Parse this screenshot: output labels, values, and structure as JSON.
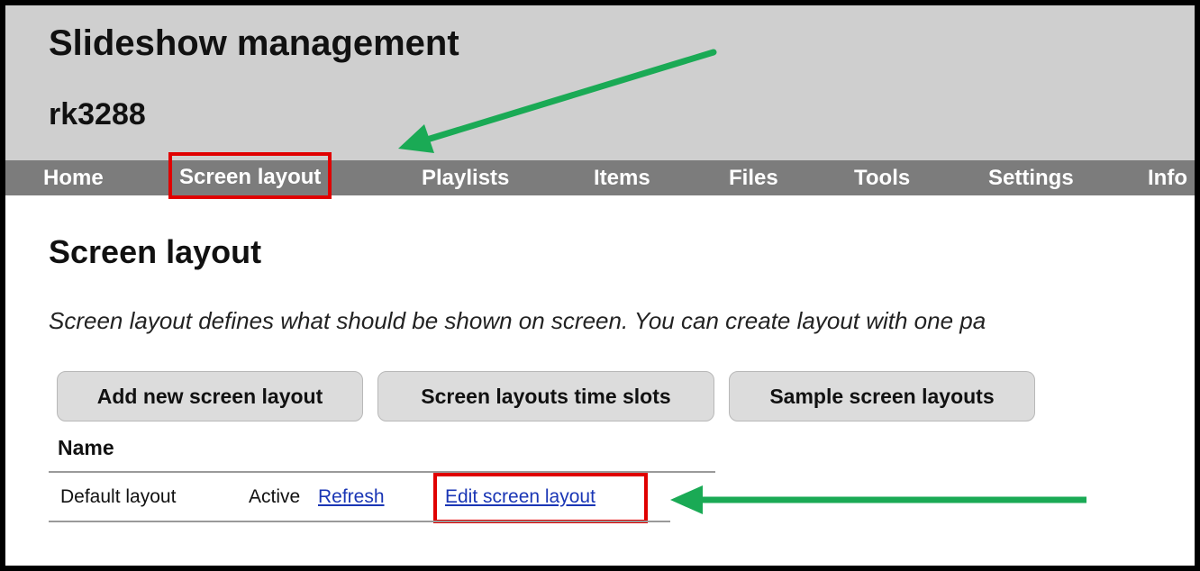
{
  "app": {
    "title": "Slideshow management",
    "device": "rk3288"
  },
  "nav": {
    "items": [
      {
        "label": "Home",
        "active": false
      },
      {
        "label": "Screen layout",
        "active": true
      },
      {
        "label": "Playlists",
        "active": false
      },
      {
        "label": "Items",
        "active": false
      },
      {
        "label": "Files",
        "active": false
      },
      {
        "label": "Tools",
        "active": false
      },
      {
        "label": "Settings",
        "active": false
      },
      {
        "label": "Info",
        "active": false
      }
    ]
  },
  "page": {
    "title": "Screen layout",
    "description": "Screen layout defines what should be shown on screen. You can create layout with one pa"
  },
  "buttons": {
    "add_new": "Add new screen layout",
    "time_slots": "Screen layouts time slots",
    "samples": "Sample screen layouts"
  },
  "table": {
    "header_name": "Name",
    "rows": [
      {
        "name": "Default layout",
        "status": "Active",
        "refresh_label": "Refresh",
        "edit_label": "Edit screen layout"
      }
    ]
  },
  "annotations": {
    "highlight_color": "#e00000",
    "arrow_color": "#1aaa55"
  }
}
